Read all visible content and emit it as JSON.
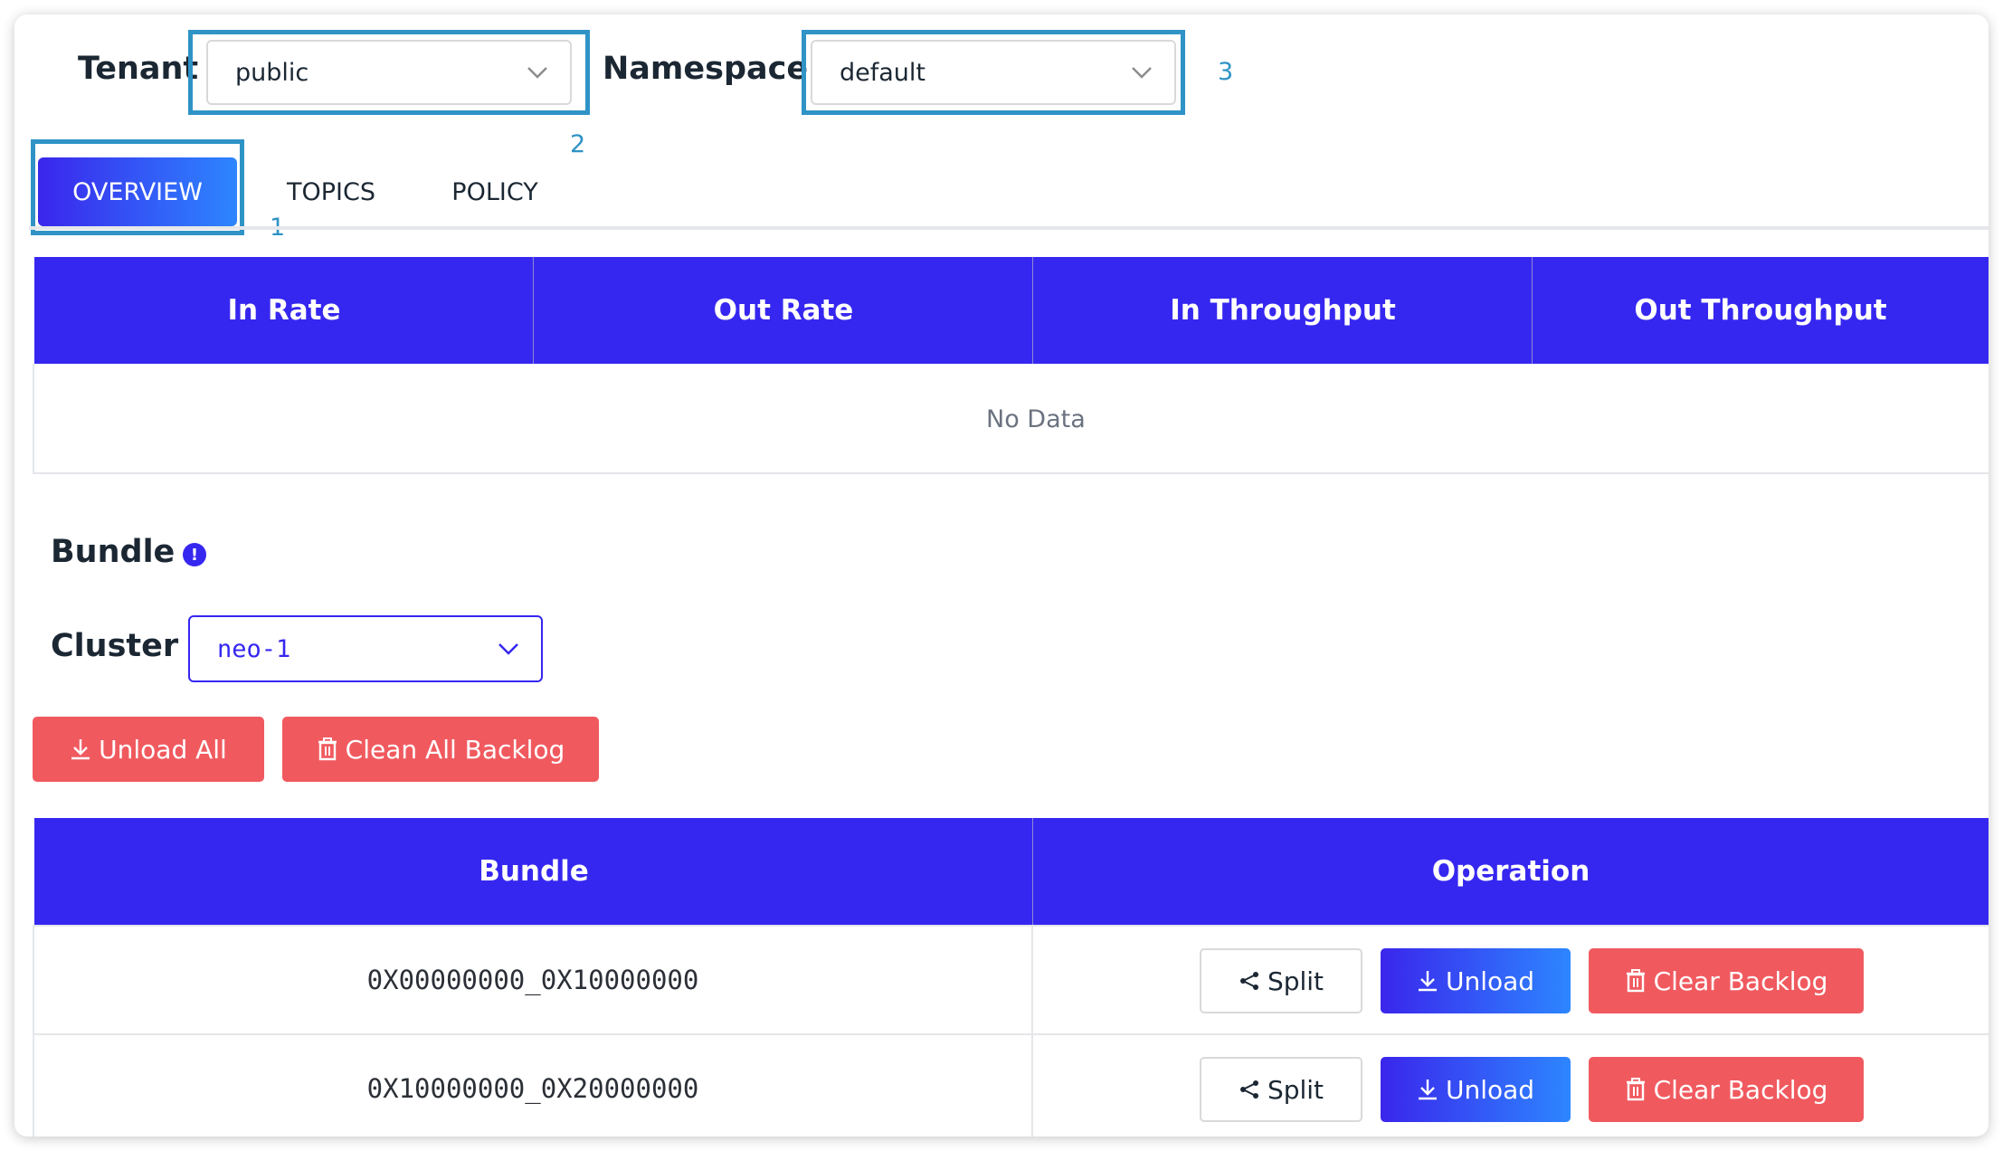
{
  "header": {
    "tenant_label": "Tenant",
    "tenant_value": "public",
    "namespace_label": "Namespace",
    "namespace_value": "default"
  },
  "annotations": [
    "1",
    "2",
    "3"
  ],
  "tabs": [
    {
      "label": "OVERVIEW",
      "active": true
    },
    {
      "label": "TOPICS",
      "active": false
    },
    {
      "label": "POLICY",
      "active": false
    }
  ],
  "stats_table": {
    "columns": [
      "In Rate",
      "Out Rate",
      "In Throughput",
      "Out Throughput"
    ],
    "empty_text": "No Data"
  },
  "bundle_section": {
    "title": "Bundle",
    "info_icon": "!",
    "cluster_label": "Cluster",
    "cluster_value": "neo-1",
    "unload_all_label": "Unload All",
    "clean_all_backlog_label": "Clean All Backlog"
  },
  "bundle_table": {
    "columns": [
      "Bundle",
      "Operation"
    ],
    "rows": [
      {
        "bundle": "0X00000000_0X10000000",
        "split": "Split",
        "unload": "Unload",
        "clear": "Clear Backlog"
      },
      {
        "bundle": "0X10000000_0X20000000",
        "split": "Split",
        "unload": "Unload",
        "clear": "Clear Backlog"
      }
    ]
  },
  "colors": {
    "primary": "#3627f0",
    "danger": "#f05a5f",
    "highlight": "#2f93c6"
  }
}
